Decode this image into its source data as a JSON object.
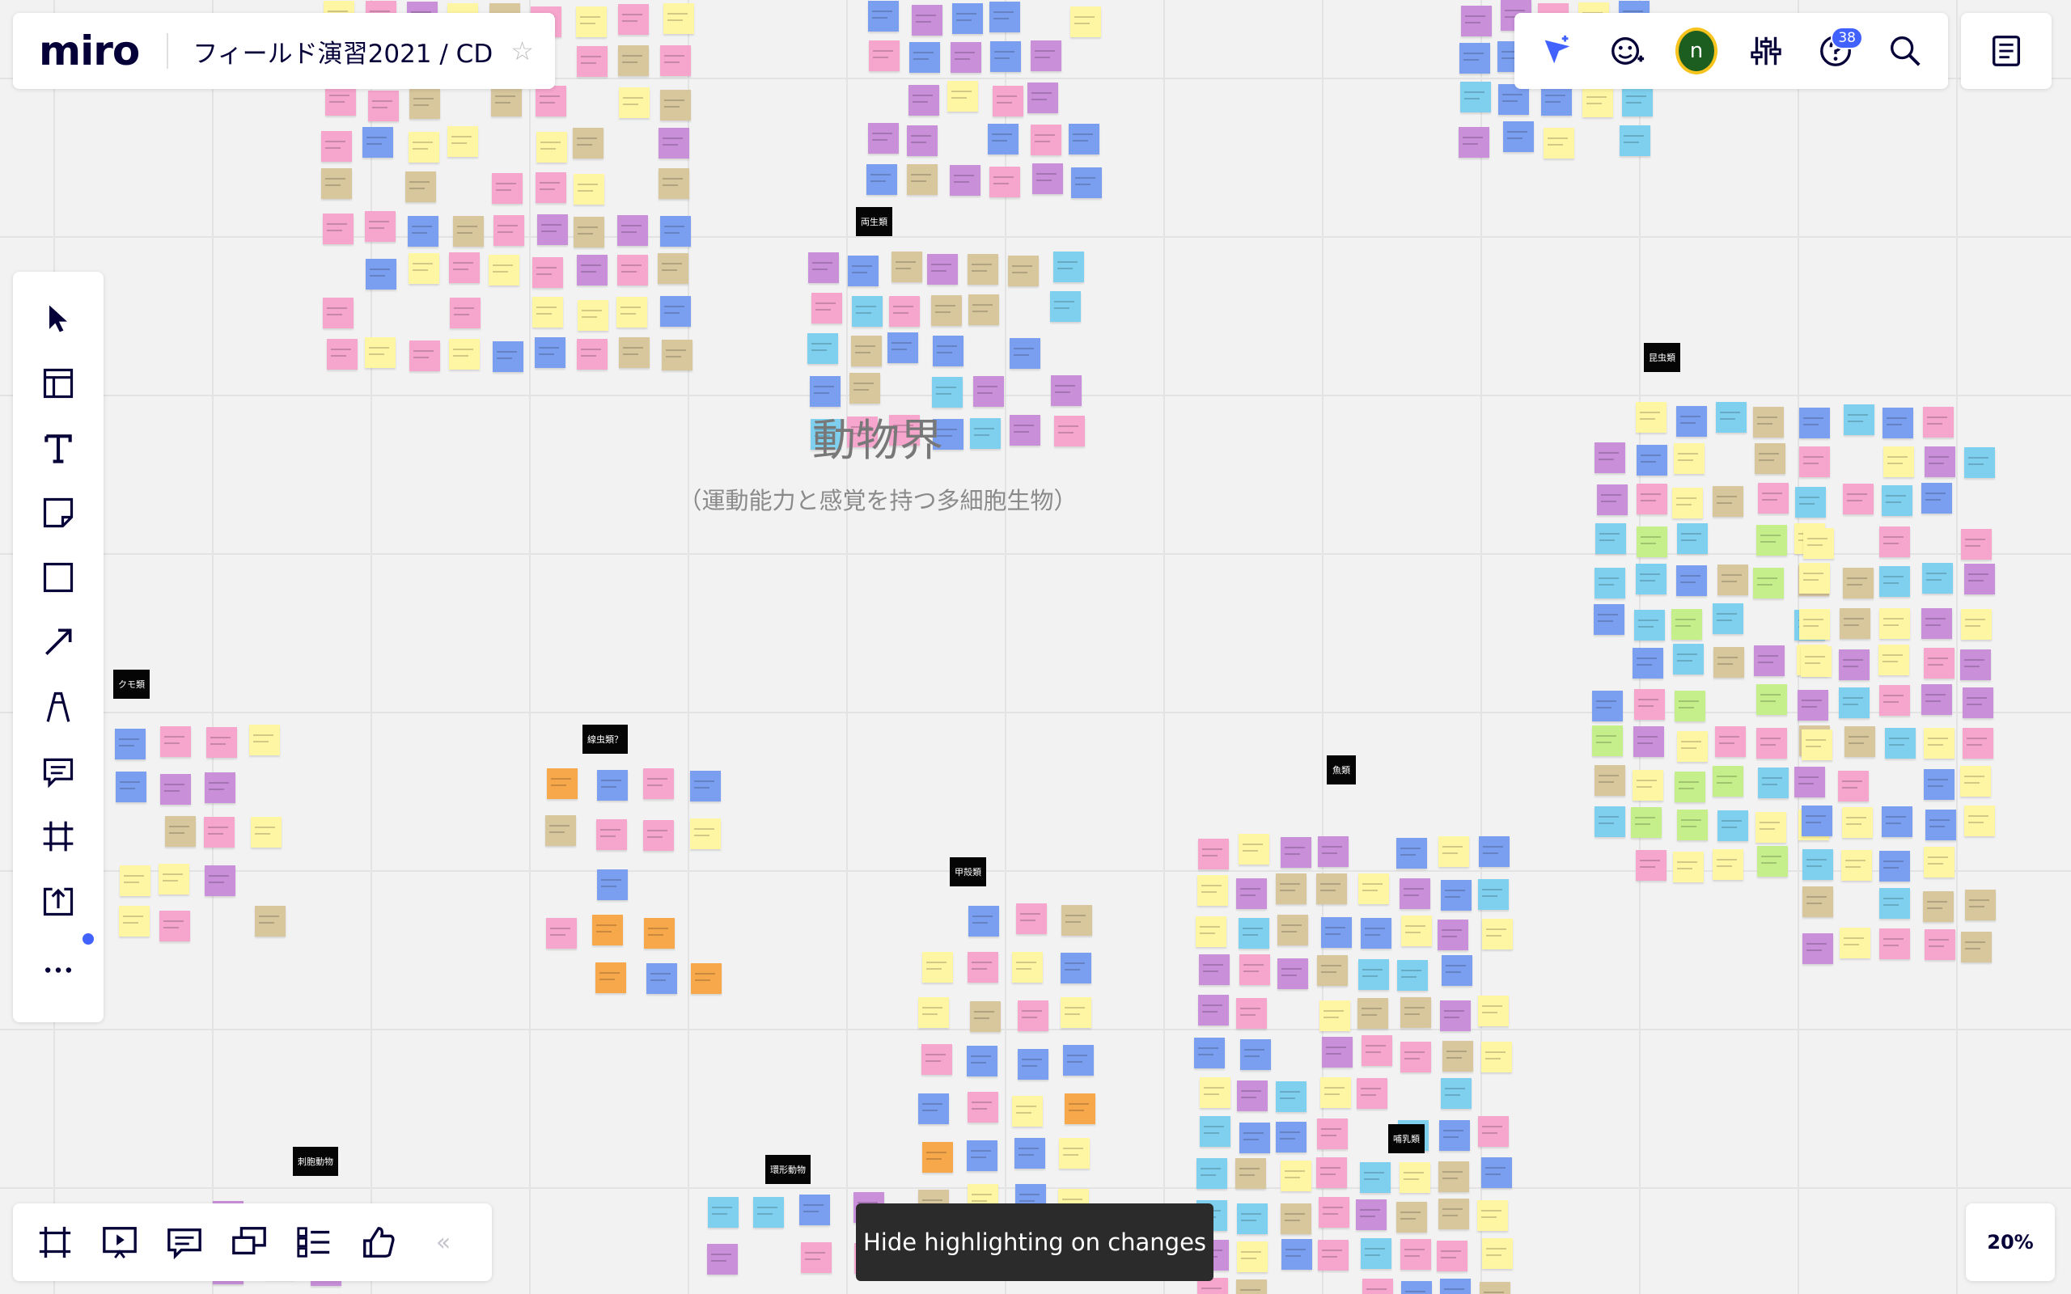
{
  "app": {
    "logo": "miro",
    "board_title": "フィールド演習2021 / CD"
  },
  "canvas": {
    "kingdom_title": "動物界",
    "kingdom_subtitle": "（運動能力と感覚を持つ多細胞生物）",
    "cluster_labels": [
      {
        "text": "両生類"
      },
      {
        "text": "昆虫類"
      },
      {
        "text": "クモ類"
      },
      {
        "text": "線虫類？"
      },
      {
        "text": "甲殻類"
      },
      {
        "text": "魚類"
      },
      {
        "text": "哺乳類"
      },
      {
        "text": "刺胞動物"
      },
      {
        "text": "環形動物"
      }
    ]
  },
  "header": {
    "help_badge_count": "38",
    "avatar_initial": "n",
    "icons": [
      "cursor-share-icon",
      "reaction-add-icon",
      "settings-sliders-icon",
      "help-icon",
      "search-icon",
      "notes-icon"
    ]
  },
  "left_toolbar": {
    "tools": [
      "select",
      "templates",
      "text",
      "sticky-note",
      "shape",
      "connection-line",
      "pen",
      "comment",
      "frame",
      "upload",
      "more"
    ]
  },
  "bottom_toolbar": {
    "tools": [
      "frames",
      "presentation",
      "comments",
      "screen-share",
      "board-outline",
      "voting"
    ]
  },
  "toast": {
    "text": "Hide highlighting on changes"
  },
  "zoom": {
    "level": "20%"
  },
  "colors": {
    "accent": "#4262ff",
    "sticky_yellow": "#fff6a3",
    "sticky_pink": "#f6a5cd",
    "sticky_purple": "#c98fd9",
    "sticky_blue": "#7b9ff0",
    "sticky_tan": "#d8c69d",
    "sticky_orange": "#f7a84b",
    "sticky_cyan": "#7ed0ee",
    "sticky_green": "#c5ef8a",
    "sticky_red": "#ef6d77"
  }
}
